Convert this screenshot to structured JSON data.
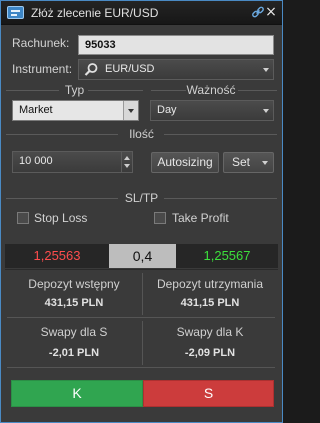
{
  "window": {
    "title": "Złóż zlecenie EUR/USD",
    "close_glyph": "×"
  },
  "account": {
    "label": "Rachunek:",
    "value": "95033"
  },
  "instrument": {
    "label": "Instrument:",
    "value": "EUR/USD",
    "icon": "search-icon"
  },
  "type": {
    "section_title": "Typ",
    "value": "Market"
  },
  "validity": {
    "section_title": "Ważność",
    "value": "Day"
  },
  "quantity": {
    "section_title": "Ilość",
    "value": "10 000",
    "autosizing_label": "Autosizing",
    "set_label": "Set"
  },
  "sltp": {
    "section_title": "SL/TP",
    "stop_loss_label": "Stop Loss",
    "take_profit_label": "Take Profit"
  },
  "prices": {
    "bid": "1,25563",
    "spread": "0,4",
    "ask": "1,25567",
    "bid_color": "#ff4d4d",
    "ask_color": "#3ce03c"
  },
  "margins": {
    "initial_label": "Depozyt wstępny",
    "initial_value": "431,15 PLN",
    "maintenance_label": "Depozyt utrzymania",
    "maintenance_value": "431,15 PLN"
  },
  "swaps": {
    "sell_label": "Swapy dla S",
    "sell_value": "-2,01 PLN",
    "buy_label": "Swapy dla K",
    "buy_value": "-2,09 PLN"
  },
  "actions": {
    "buy_label": "K",
    "sell_label": "S",
    "buy_color": "#30a550",
    "sell_color": "#cc3c3c"
  }
}
